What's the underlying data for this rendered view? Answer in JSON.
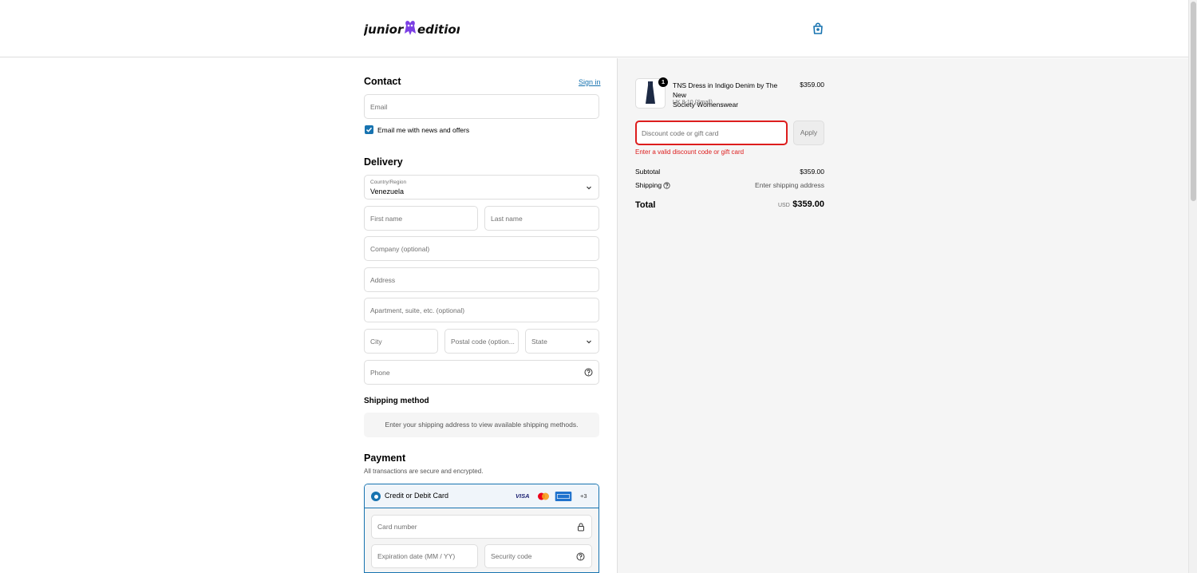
{
  "brand": {
    "logo_text_left": "junior",
    "logo_text_right": "edition",
    "accent": "#1773b0",
    "logo_mark_color": "#7b3fe4"
  },
  "contact": {
    "title": "Contact",
    "sign_in": "Sign in",
    "email_placeholder": "Email",
    "newsletter_label": "Email me with news and offers",
    "newsletter_checked": true
  },
  "delivery": {
    "title": "Delivery",
    "country_label": "Country/Region",
    "country_value": "Venezuela",
    "first_name": "First name",
    "last_name": "Last name",
    "company": "Company (optional)",
    "address": "Address",
    "apartment": "Apartment, suite, etc. (optional)",
    "city": "City",
    "postal": "Postal code (option...",
    "state": "State",
    "phone": "Phone"
  },
  "shipping_method": {
    "title": "Shipping method",
    "message": "Enter your shipping address to view available shipping methods."
  },
  "payment": {
    "title": "Payment",
    "subtitle": "All transactions are secure and encrypted.",
    "option_label": "Credit or Debit Card",
    "visa": "VISA",
    "more_cards": "+3",
    "card_number": "Card number",
    "expiration": "Expiration date (MM / YY)",
    "security_code": "Security code"
  },
  "order": {
    "item_name_line1": "TNS Dress in Indigo Denim by The New",
    "item_name_line2": "Society Womenswear",
    "item_variant": "UK 8-10 (Small)",
    "item_price": "$359.00",
    "item_quantity": "1",
    "discount_placeholder": "Discount code or gift card",
    "apply_label": "Apply",
    "discount_error": "Enter a valid discount code or gift card",
    "subtotal_label": "Subtotal",
    "subtotal_value": "$359.00",
    "shipping_label": "Shipping",
    "shipping_value": "Enter shipping address",
    "total_label": "Total",
    "total_currency": "USD",
    "total_value": "$359.00"
  }
}
